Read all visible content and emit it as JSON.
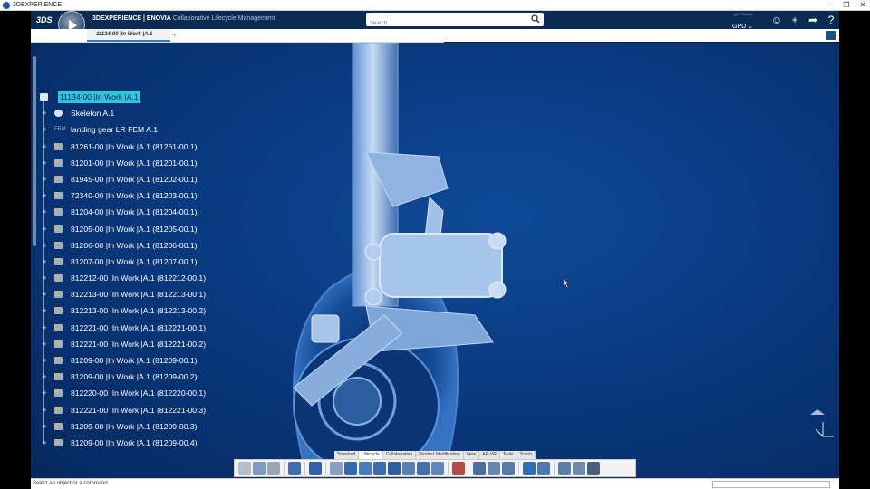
{
  "window": {
    "title": "3DEXPERIENCE",
    "minimize": "–",
    "maximize": "❐",
    "close": "✕"
  },
  "topbar": {
    "brand_main": "3DEXPERIENCE | ENOVIA",
    "brand_sub": "Collaborative Lifecycle Management",
    "search_placeholder": "Search",
    "user_role": "par. Partner",
    "user_name": "GPD",
    "icons": [
      "search-icon",
      "tag-icon",
      "user-icon",
      "plus-icon",
      "share-icon",
      "help-icon"
    ]
  },
  "tabs": {
    "active": "11134-00 |In Work |A.1",
    "add": "+"
  },
  "tree": {
    "root": "11134-00 |In Work |A.1",
    "items": [
      {
        "label": "Skeleton A.1",
        "icon": "skeleton"
      },
      {
        "label": "landing gear LR FEM A.1",
        "icon": "fem"
      },
      {
        "label": "81261-00 |In Work |A.1 (81261-00.1)",
        "icon": "part"
      },
      {
        "label": "81201-00 |In Work |A.1 (81201-00.1)",
        "icon": "part"
      },
      {
        "label": "81945-00 |In Work |A.1 (81202-00.1)",
        "icon": "part"
      },
      {
        "label": "72340-00 |In Work |A.1 (81203-00.1)",
        "icon": "part"
      },
      {
        "label": "81204-00 |In Work |A.1 (81204-00.1)",
        "icon": "part"
      },
      {
        "label": "81205-00 |In Work |A.1 (81205-00.1)",
        "icon": "part"
      },
      {
        "label": "81206-00 |In Work |A.1 (81206-00.1)",
        "icon": "part"
      },
      {
        "label": "81207-00 |In Work |A.1 (81207-00.1)",
        "icon": "part"
      },
      {
        "label": "812212-00 |In Work |A.1 (812212-00.1)",
        "icon": "part"
      },
      {
        "label": "812213-00 |In Work |A.1 (812213-00.1)",
        "icon": "part"
      },
      {
        "label": "812213-00 |In Work |A.1 (812213-00.2)",
        "icon": "part"
      },
      {
        "label": "812221-00 |In Work |A.1 (812221-00.1)",
        "icon": "part"
      },
      {
        "label": "812221-00 |In Work |A.1 (812221-00.2)",
        "icon": "part"
      },
      {
        "label": "81209-00 |In Work |A.1 (81209-00.1)",
        "icon": "part"
      },
      {
        "label": "81209-00 |In Work |A.1 (81209-00.2)",
        "icon": "part"
      },
      {
        "label": "812220-00 |In Work |A.1 (812220-00.1)",
        "icon": "part"
      },
      {
        "label": "812221-00 |In Work |A.1 (812221-00.3)",
        "icon": "part"
      },
      {
        "label": "81209-00 |In Work |A.1 (81209-00.3)",
        "icon": "part"
      },
      {
        "label": "81209-00 |In Work |A.1 (81209-00.4)",
        "icon": "part"
      }
    ]
  },
  "action_tabs": [
    "Standard",
    "Lifecycle",
    "Collaboration",
    "Product Modification",
    "View",
    "AR-VR",
    "Tools",
    "Touch"
  ],
  "action_tab_active": "Lifecycle",
  "status": {
    "message": "Select an object or a command"
  },
  "colors": {
    "topbar": "#0c2b52",
    "viewport": "#0a3a80",
    "root_highlight": "#2fc5df"
  }
}
